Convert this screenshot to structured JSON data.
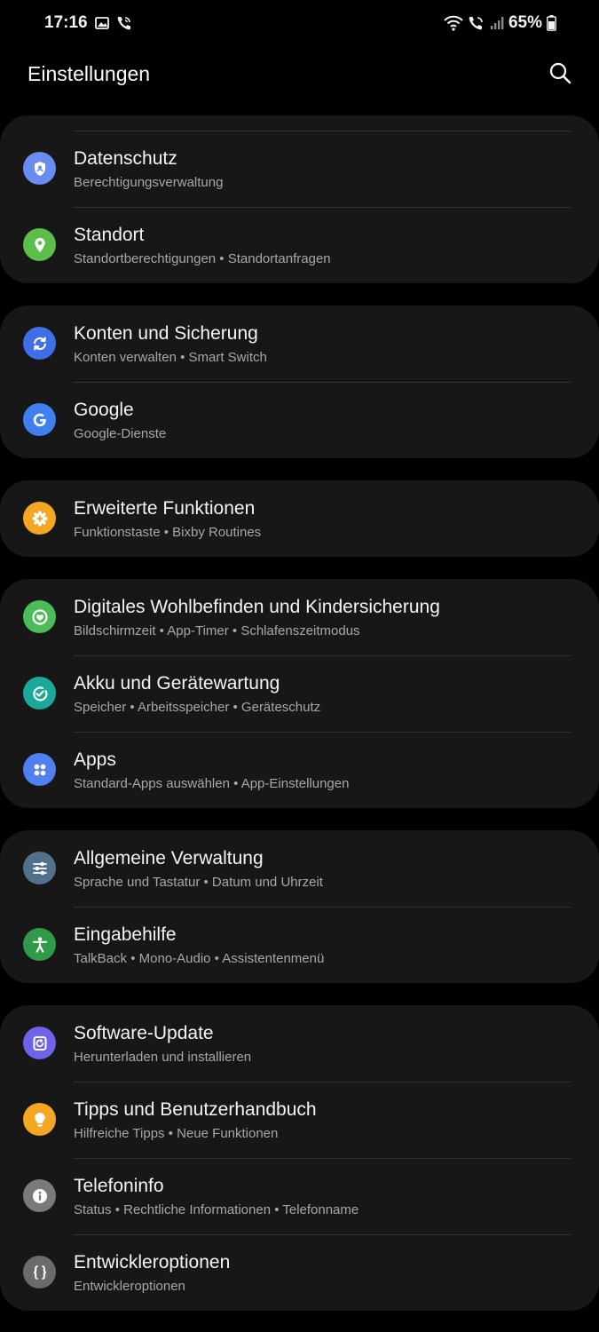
{
  "status_bar": {
    "time": "17:16",
    "battery": "65%"
  },
  "header": {
    "title": "Einstellungen",
    "search_icon": "search-icon"
  },
  "groups": [
    {
      "items": [
        {
          "title": "Datenschutz",
          "subtitle": "Berechtigungsverwaltung",
          "icon": "privacy-shield-icon",
          "color": "#6a8cf0"
        },
        {
          "title": "Standort",
          "subtitle": "Standortberechtigungen • Standortanfragen",
          "icon": "location-pin-icon",
          "color": "#5cbf4a"
        }
      ]
    },
    {
      "items": [
        {
          "title": "Konten und Sicherung",
          "subtitle": "Konten verwalten • Smart Switch",
          "icon": "sync-icon",
          "color": "#3f6fe6"
        },
        {
          "title": "Google",
          "subtitle": "Google-Dienste",
          "icon": "google-icon",
          "color": "#3f7ff0"
        }
      ]
    },
    {
      "items": [
        {
          "title": "Erweiterte Funktionen",
          "subtitle": "Funktionstaste • Bixby Routines",
          "icon": "gear-plus-icon",
          "color": "#f5a623"
        }
      ]
    },
    {
      "items": [
        {
          "title": "Digitales Wohlbefinden und Kindersicherung",
          "subtitle": "Bildschirmzeit • App-Timer • Schlafenszeitmodus",
          "icon": "heart-circle-icon",
          "color": "#4cbb5a"
        },
        {
          "title": "Akku und Gerätewartung",
          "subtitle": "Speicher • Arbeitsspeicher • Geräteschutz",
          "icon": "device-care-icon",
          "color": "#1aa89a"
        },
        {
          "title": "Apps",
          "subtitle": "Standard-Apps auswählen • App-Einstellungen",
          "icon": "apps-grid-icon",
          "color": "#4f7ff0"
        }
      ]
    },
    {
      "items": [
        {
          "title": "Allgemeine Verwaltung",
          "subtitle": "Sprache und Tastatur • Datum und Uhrzeit",
          "icon": "sliders-icon",
          "color": "#53708a"
        },
        {
          "title": "Eingabehilfe",
          "subtitle": "TalkBack • Mono-Audio • Assistentenmenü",
          "icon": "accessibility-icon",
          "color": "#2f9b4a"
        }
      ]
    },
    {
      "items": [
        {
          "title": "Software-Update",
          "subtitle": "Herunterladen und installieren",
          "icon": "software-update-icon",
          "color": "#6f64e8"
        },
        {
          "title": "Tipps und Benutzerhandbuch",
          "subtitle": "Hilfreiche Tipps • Neue Funktionen",
          "icon": "lightbulb-icon",
          "color": "#f5a623"
        },
        {
          "title": "Telefoninfo",
          "subtitle": "Status • Rechtliche Informationen • Telefonname",
          "icon": "info-icon",
          "color": "#7a7a7a"
        },
        {
          "title": "Entwickleroptionen",
          "subtitle": "Entwickleroptionen",
          "icon": "braces-icon",
          "color": "#6b6b6b"
        }
      ]
    }
  ]
}
